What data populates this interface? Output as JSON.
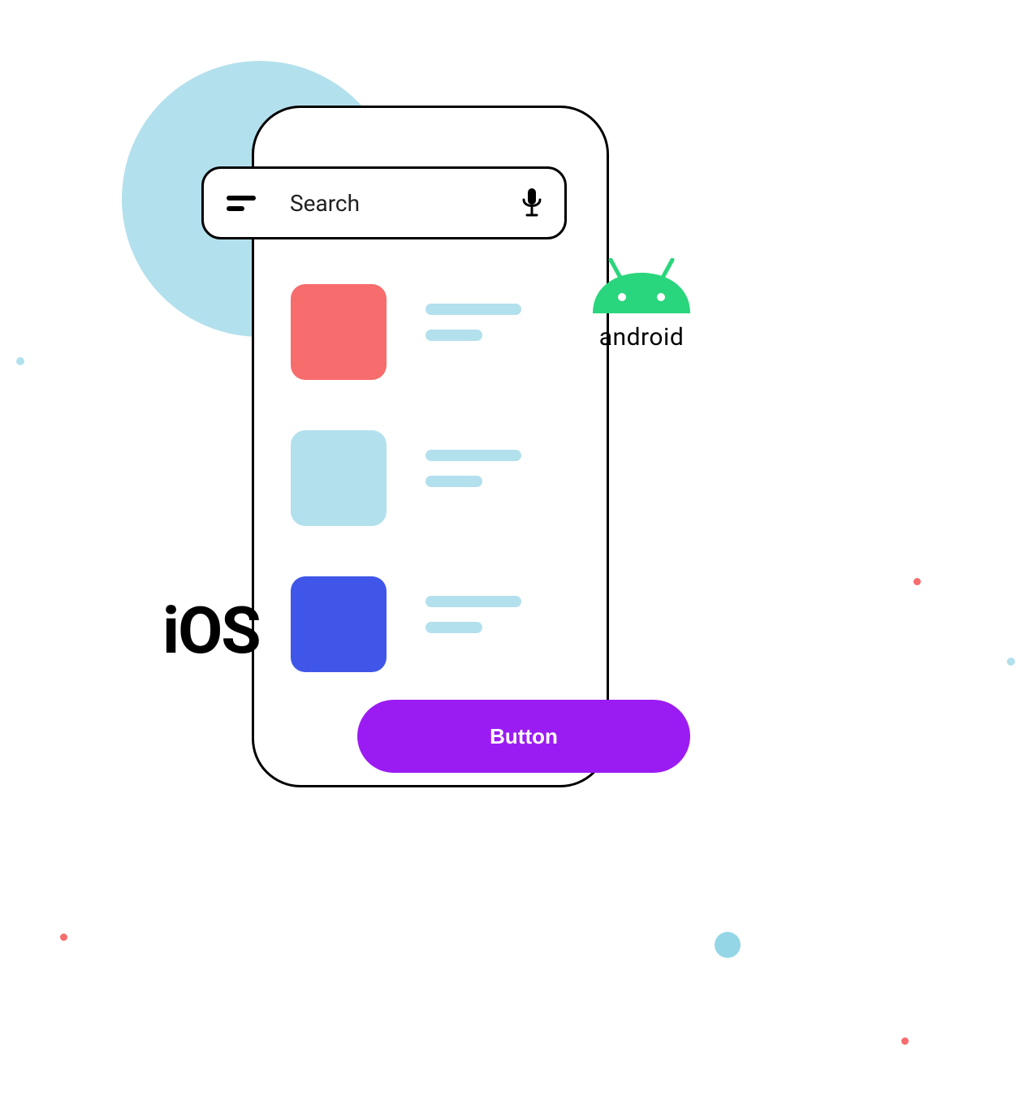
{
  "search": {
    "placeholder": "Search"
  },
  "items": [
    {
      "color": "#f76c6c"
    },
    {
      "color": "#b3e0ed"
    },
    {
      "color": "#4056e8"
    }
  ],
  "cta": {
    "label": "Button",
    "bg": "#9b1cf2"
  },
  "platforms": {
    "android_label": "android",
    "android_color": "#2ad67d",
    "ios_label": "iOS"
  },
  "accent": {
    "line_color": "#b3e0ed",
    "bg_circle": "#b3e0ed"
  }
}
